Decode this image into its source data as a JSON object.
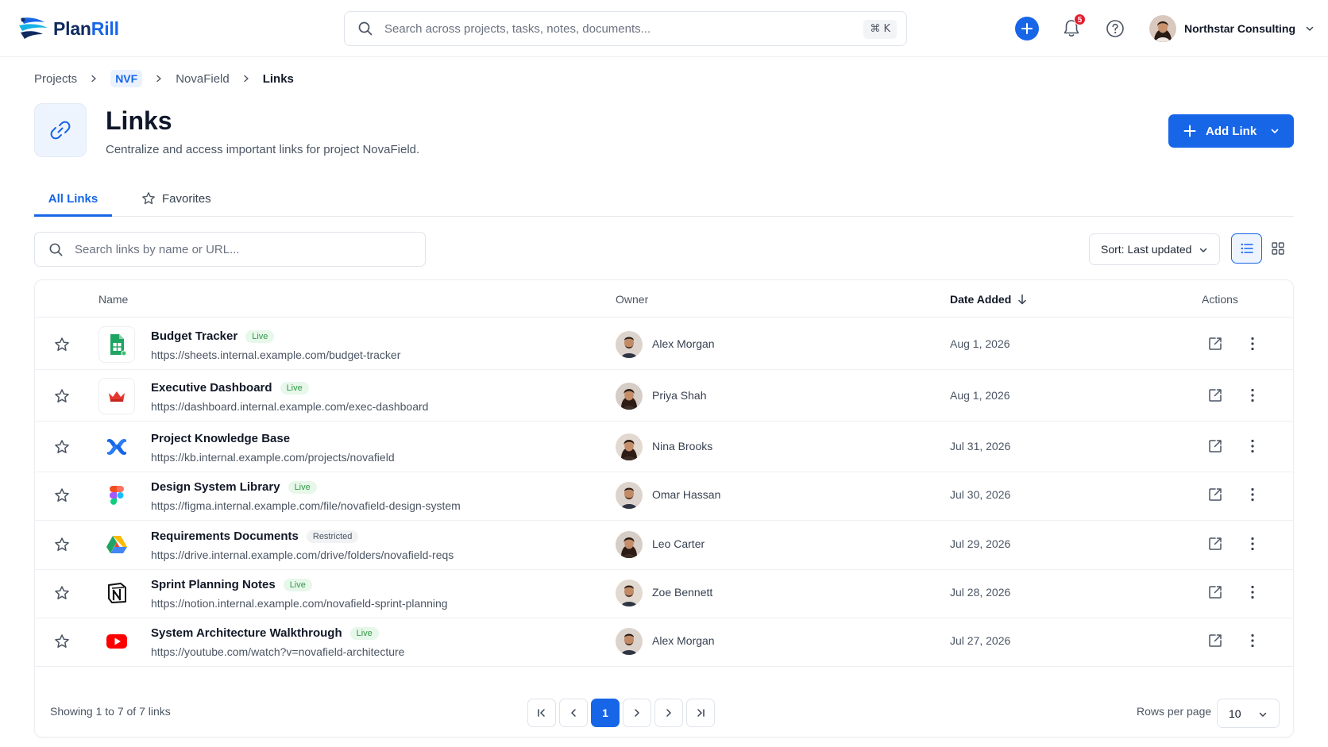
{
  "app": {
    "logo_plan": "Plan",
    "logo_rill": "Rill",
    "brand_color": "#1766e8",
    "search_placeholder": "Search across projects, tasks, notes, documents...",
    "search_shortcut": "⌘ K",
    "notifications_count": "5",
    "account_name": "Northstar Consulting"
  },
  "breadcrumb": {
    "projects": "Projects",
    "project_code": "NVF",
    "project_name": "NovaField",
    "current": "Links"
  },
  "page": {
    "title": "Links",
    "subtitle": "Centralize and access important links for project NovaField.",
    "add_button": "Add Link"
  },
  "tabs": {
    "all": "All Links",
    "favorites": "Favorites",
    "active": "All Links"
  },
  "toolbar": {
    "search_placeholder": "Search links by name or URL...",
    "sort_label": "Sort: Last updated",
    "view_mode": "list"
  },
  "table": {
    "headers": {
      "name": "Name",
      "owner": "Owner",
      "date_added": "Date Added",
      "actions": "Actions"
    },
    "sort_column": "Date Added",
    "sort_direction": "descending",
    "rows": [
      {
        "name": "Budget Tracker",
        "badge": "Live",
        "badge_type": "live",
        "url": "https://sheets.internal.example.com/budget-tracker",
        "owner": "Alex Morgan",
        "owner_gender": "m",
        "date": "Aug 1, 2026",
        "icon": "google-sheets-icon"
      },
      {
        "name": "Executive Dashboard",
        "badge": "Live",
        "badge_type": "live",
        "url": "https://dashboard.internal.example.com/exec-dashboard",
        "owner": "Priya Shah",
        "owner_gender": "f",
        "date": "Aug 1, 2026",
        "icon": "dashboard-crown-icon"
      },
      {
        "name": "Project Knowledge Base",
        "badge": "",
        "badge_type": "none",
        "url": "https://kb.internal.example.com/projects/novafield",
        "owner": "Nina Brooks",
        "owner_gender": "f",
        "date": "Jul 31, 2026",
        "icon": "confluence-icon"
      },
      {
        "name": "Design System Library",
        "badge": "Live",
        "badge_type": "live",
        "url": "https://figma.internal.example.com/file/novafield-design-system",
        "owner": "Omar Hassan",
        "owner_gender": "m",
        "date": "Jul 30, 2026",
        "icon": "figma-icon"
      },
      {
        "name": "Requirements Documents",
        "badge": "Restricted",
        "badge_type": "restricted",
        "url": "https://drive.internal.example.com/drive/folders/novafield-reqs",
        "owner": "Leo Carter",
        "owner_gender": "f",
        "date": "Jul 29, 2026",
        "icon": "google-drive-icon"
      },
      {
        "name": "Sprint Planning Notes",
        "badge": "Live",
        "badge_type": "live",
        "url": "https://notion.internal.example.com/novafield-sprint-planning",
        "owner": "Zoe Bennett",
        "owner_gender": "m",
        "date": "Jul 28, 2026",
        "icon": "notion-icon"
      },
      {
        "name": "System Architecture Walkthrough",
        "badge": "Live",
        "badge_type": "live",
        "url": "https://youtube.com/watch?v=novafield-architecture",
        "owner": "Alex Morgan",
        "owner_gender": "m",
        "date": "Jul 27, 2026",
        "icon": "youtube-icon"
      }
    ]
  },
  "footer": {
    "showing": "Showing 1 to 7 of 7 links",
    "current_page": "1",
    "rows_per_page_label": "Rows per page",
    "rows_per_page": "10"
  }
}
